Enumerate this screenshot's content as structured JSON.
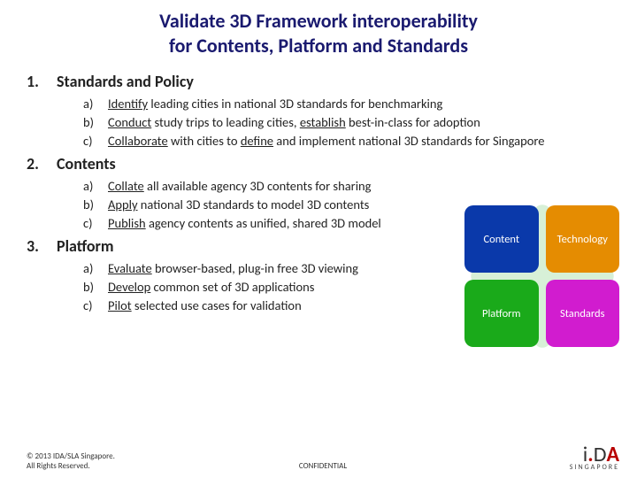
{
  "title_l1": "Validate 3D Framework interoperability",
  "title_l2": "for Contents, Platform and Standards",
  "sections": [
    {
      "num": "1.",
      "heading": "Standards and Policy",
      "items": [
        {
          "let": "a)",
          "lead": "Identify",
          "rest": " leading cities in national 3D standards for benchmarking"
        },
        {
          "let": "b)",
          "lead": "Conduct",
          "rest": " study trips to leading cities, ",
          "lead2": "establish",
          "rest2": " best-in-class for adoption"
        },
        {
          "let": "c)",
          "lead": "Collaborate",
          "rest": " with cities to ",
          "lead2": "define",
          "rest2": " and implement national 3D standards for Singapore"
        }
      ]
    },
    {
      "num": "2.",
      "heading": "Contents",
      "items": [
        {
          "let": "a)",
          "lead": "Collate",
          "rest": " all available agency 3D contents for sharing"
        },
        {
          "let": "b)",
          "lead": "Apply",
          "rest": " national 3D standards to model 3D contents"
        },
        {
          "let": "c)",
          "lead": "Publish",
          "rest": " agency contents as unified, shared 3D model"
        }
      ]
    },
    {
      "num": "3.",
      "heading": "Platform",
      "items": [
        {
          "let": "a)",
          "lead": "Evaluate",
          "rest": " browser-based, plug-in free 3D viewing"
        },
        {
          "let": "b)",
          "lead": "Develop",
          "rest": " common set of 3D applications"
        },
        {
          "let": "c)",
          "lead": "Pilot",
          "rest": " selected use cases for validation"
        }
      ]
    }
  ],
  "quads": {
    "tl": "Content",
    "tr": "Technology",
    "bl": "Platform",
    "br": "Standards"
  },
  "footer": {
    "copyright_l1": "© 2013 IDA/SLA Singapore.",
    "copyright_l2": "All Rights Reserved.",
    "confidential": "CONFIDENTIAL",
    "logo_i": "i",
    "logo_dot": ".",
    "logo_d": "D",
    "logo_a": "A",
    "logo_sg": "SINGAPORE"
  }
}
